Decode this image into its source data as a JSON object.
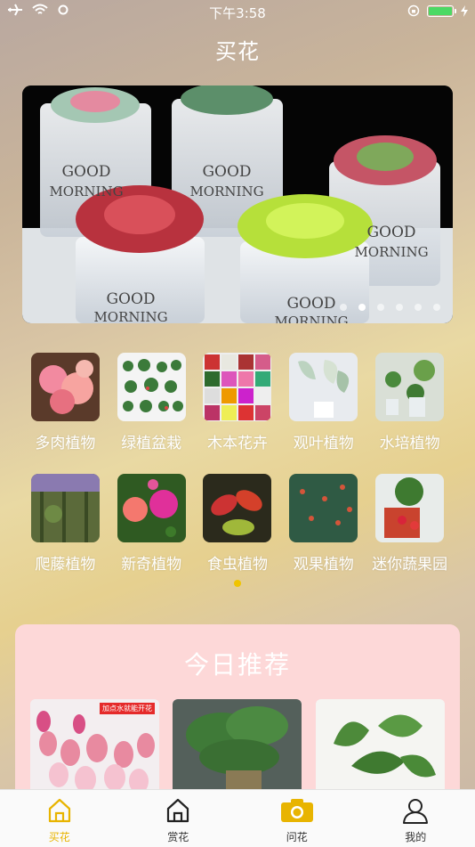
{
  "status_bar": {
    "time": "下午3:58"
  },
  "header": {
    "title": "买花"
  },
  "categories": [
    {
      "label": "多肉植物"
    },
    {
      "label": "绿植盆栽"
    },
    {
      "label": "木本花卉"
    },
    {
      "label": "观叶植物"
    },
    {
      "label": "水培植物"
    },
    {
      "label": "爬藤植物"
    },
    {
      "label": "新奇植物"
    },
    {
      "label": "食虫植物"
    },
    {
      "label": "观果植物"
    },
    {
      "label": "迷你蔬果园"
    }
  ],
  "banner": {
    "pot_text_line1": "GOOD",
    "pot_text_line2": "MORNING",
    "slide_count": 6,
    "active_slide": 2
  },
  "recommend": {
    "title": "今日推荐",
    "card1_tag": "加点水就能开花"
  },
  "tabs": [
    {
      "label": "买花",
      "icon": "home-icon",
      "active": true
    },
    {
      "label": "赏花",
      "icon": "home-outline-icon",
      "active": false
    },
    {
      "label": "问花",
      "icon": "camera-icon",
      "active": false
    },
    {
      "label": "我的",
      "icon": "person-icon",
      "active": false
    }
  ],
  "colors": {
    "accent": "#e8b400",
    "recommend_bg": "#fdd8d8",
    "battery": "#4cd964"
  }
}
